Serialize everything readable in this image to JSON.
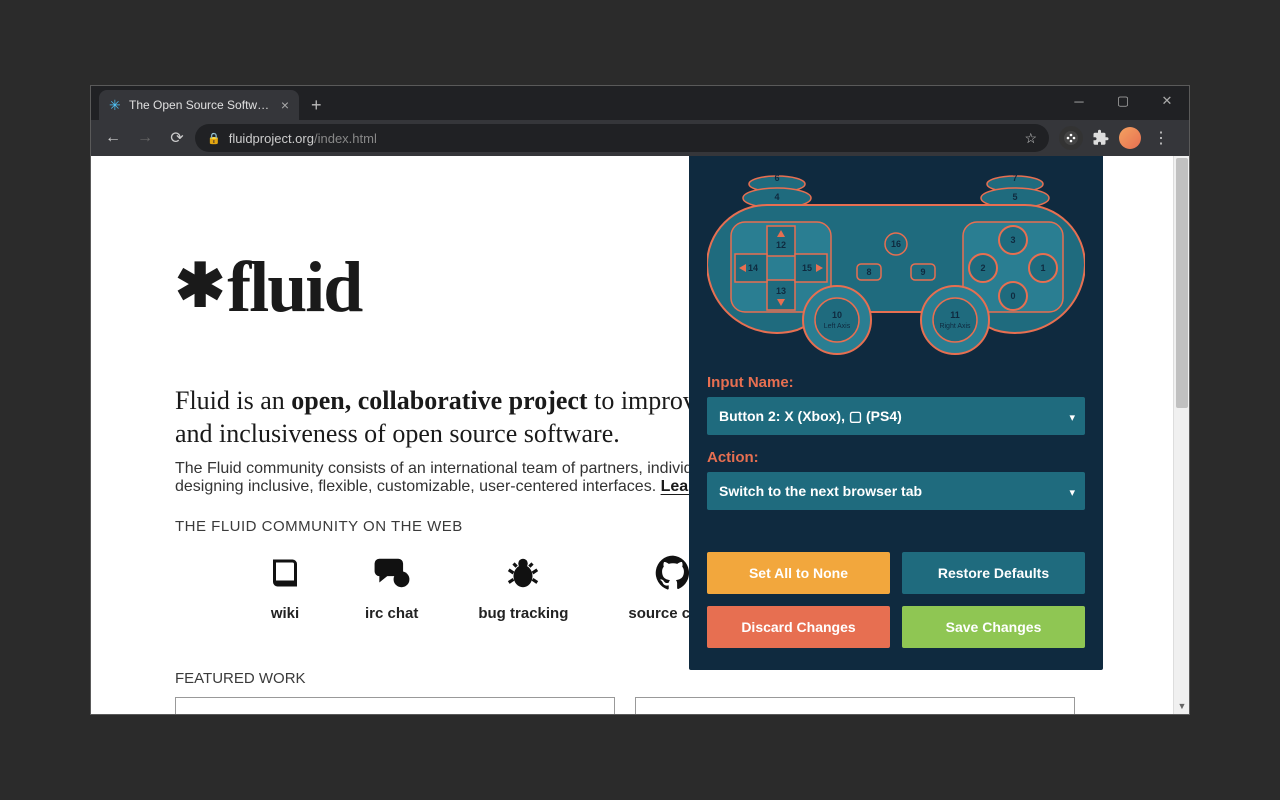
{
  "browser": {
    "tab_title": "The Open Source Software Comm",
    "url_host": "fluidproject.org",
    "url_path": "/index.html"
  },
  "page": {
    "logo_text": "fluid",
    "lead_prefix": "Fluid is an ",
    "lead_bold": "open, collaborative project",
    "lead_suffix": " to improve the user experience and inclusiveness of open source software.",
    "sublead": "The Fluid community consists of an international team of partners, individuals, and institutions focused on designing inclusive, flexible, customizable, user-centered interfaces. ",
    "learn_more": "Learn more about Fluid",
    "community_heading": "THE FLUID COMMUNITY ON THE WEB",
    "community": [
      {
        "label": "wiki"
      },
      {
        "label": "irc chat"
      },
      {
        "label": "bug tracking"
      },
      {
        "label": "source code"
      }
    ],
    "featured_heading": "FEATURED WORK"
  },
  "popup": {
    "input_label": "Input Name:",
    "input_value": "Button 2: X (Xbox), ▢ (PS4)",
    "action_label": "Action:",
    "action_value": "Switch to the next browser tab",
    "buttons": {
      "set_none": "Set All to None",
      "restore": "Restore Defaults",
      "discard": "Discard Changes",
      "save": "Save Changes"
    },
    "controller": {
      "nums": {
        "topL1": "6",
        "topL2": "4",
        "topR1": "7",
        "topR2": "5",
        "dpad_up": "12",
        "dpad_down": "13",
        "dpad_left": "14",
        "dpad_right": "15",
        "select": "8",
        "start": "9",
        "home": "16",
        "face_top": "3",
        "face_right": "1",
        "face_bottom": "0",
        "face_left": "2",
        "lstick": "10",
        "rstick": "11"
      },
      "lstick_label": "Left Axis",
      "rstick_label": "Right Axis"
    }
  }
}
